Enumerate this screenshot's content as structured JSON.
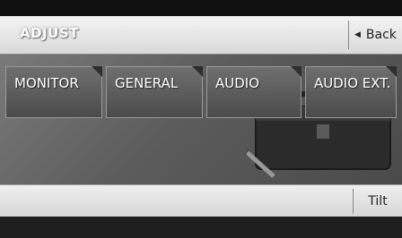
{
  "header": {
    "title": "ADJUST",
    "back_label": "Back"
  },
  "tabs": [
    {
      "label": "MONITOR"
    },
    {
      "label": "GENERAL"
    },
    {
      "label": "AUDIO"
    },
    {
      "label": "AUDIO EXT."
    }
  ],
  "bottom": {
    "tilt_label": "Tilt"
  },
  "icons": [
    "back-arrow-icon",
    "toolbox-icon",
    "screwdriver-icon"
  ]
}
